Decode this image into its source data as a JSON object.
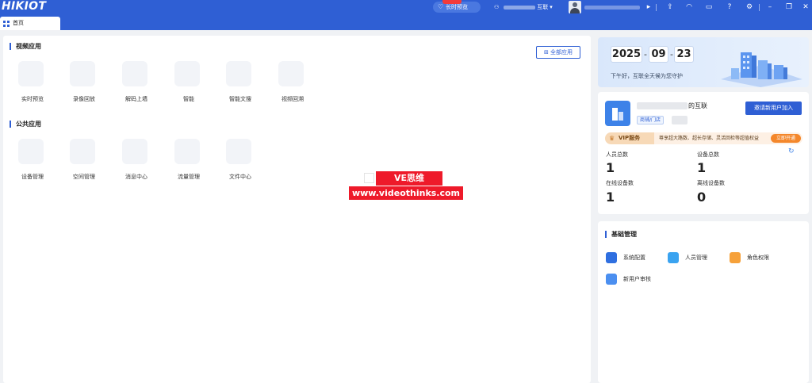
{
  "header": {
    "logo": "HIKIOT",
    "live_button_label": "长时预览",
    "user_suffix": "互联",
    "icons": [
      "upload-icon",
      "headset-icon",
      "message-icon",
      "help-icon",
      "settings-icon",
      "minimize-icon",
      "restore-icon",
      "close-icon"
    ]
  },
  "tabs": [
    {
      "label": "首页"
    }
  ],
  "main": {
    "video_section_title": "视频应用",
    "all_apps_label": "全部应用",
    "video_apps": [
      {
        "label": "实时预览"
      },
      {
        "label": "录像回放"
      },
      {
        "label": "解码上墙"
      },
      {
        "label": "智能"
      },
      {
        "label": "智能文搜"
      },
      {
        "label": "视频回溯"
      }
    ],
    "public_section_title": "公共应用",
    "public_apps": [
      {
        "label": "设备管理"
      },
      {
        "label": "空间管理"
      },
      {
        "label": "消息中心"
      },
      {
        "label": "流量管理"
      },
      {
        "label": "文件中心"
      }
    ]
  },
  "watermark": {
    "line1": "VE思维",
    "line2": "www.videothinks.com"
  },
  "date_card": {
    "year": "2025",
    "month": "09",
    "day": "23",
    "sep": "-",
    "greeting": "下午好，互联全天候为您守护"
  },
  "org_card": {
    "name_suffix": "的互联",
    "tag": "商铺/门店",
    "invite_label": "邀请新用户加入",
    "vip_label": "VIP服务",
    "vip_desc": "尊享超大路数、超长存储、灵活回检等超值权益",
    "vip_button": "立即开通",
    "stats": [
      {
        "label": "人员总数",
        "value": "1"
      },
      {
        "label": "设备总数",
        "value": "1"
      },
      {
        "label": "在线设备数",
        "value": "1"
      },
      {
        "label": "离线设备数",
        "value": "0"
      }
    ]
  },
  "management": {
    "title": "基础管理",
    "items": [
      {
        "label": "系统配置"
      },
      {
        "label": "人员管理"
      },
      {
        "label": "角色权限"
      },
      {
        "label": "新用户审核"
      }
    ]
  },
  "colors": {
    "brand": "#2f5fd4",
    "vip_button": "#f4872b",
    "watermark_red": "#ee1a2a"
  }
}
